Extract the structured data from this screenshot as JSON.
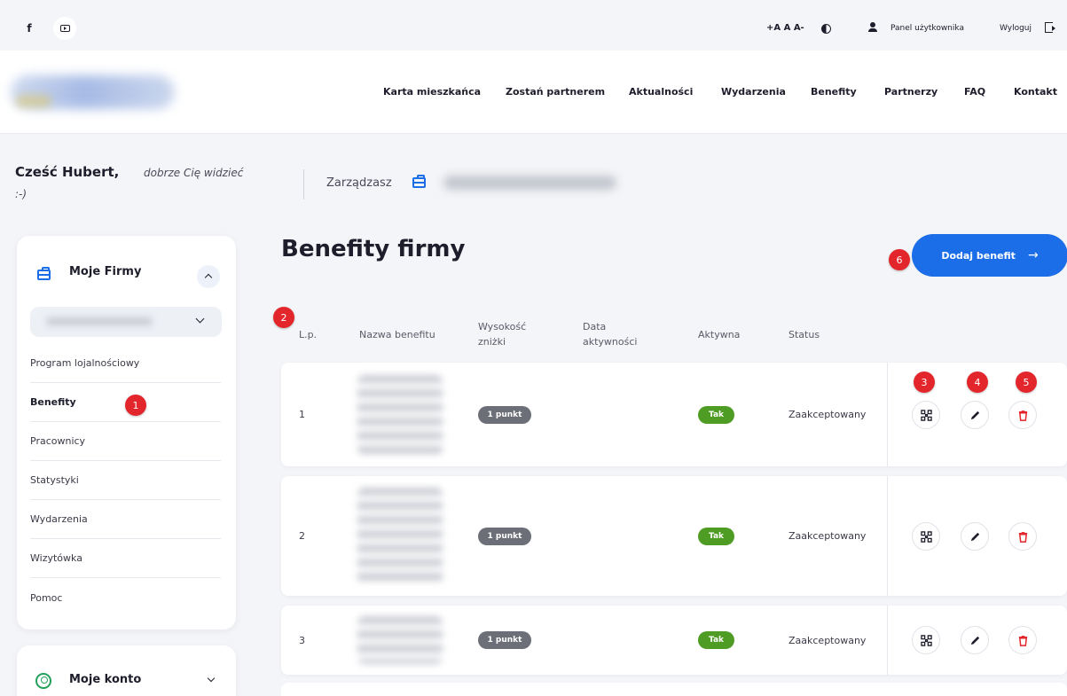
{
  "topbar": {
    "social": [
      {
        "icon": "facebook-icon",
        "label": "f"
      },
      {
        "icon": "youtube-icon"
      }
    ],
    "font_size_controls": "+A A A-",
    "contrast_icon": "contrast-icon",
    "user_panel_label": "Panel użytkownika",
    "logout_label": "Wyloguj"
  },
  "nav": {
    "items": [
      "Karta mieszkańca",
      "Zostań partnerem",
      "Aktualności",
      "Wydarzenia",
      "Benefity",
      "Partnerzy",
      "FAQ",
      "Kontakt"
    ]
  },
  "greeting": {
    "name": "Cześć Hubert,",
    "sub_line1": "dobrze Cię widzieć",
    "sub_line2": ":-)",
    "manage_label": "Zarządzasz"
  },
  "sidebar": {
    "firms_title": "Moje Firmy",
    "items": [
      {
        "label": "Program lojalnościowy",
        "active": false
      },
      {
        "label": "Benefity",
        "active": true
      },
      {
        "label": "Pracownicy",
        "active": false
      },
      {
        "label": "Statystyki",
        "active": false
      },
      {
        "label": "Wydarzenia",
        "active": false
      },
      {
        "label": "Wizytówka",
        "active": false
      },
      {
        "label": "Pomoc",
        "active": false
      }
    ],
    "account_title": "Moje konto"
  },
  "main": {
    "title": "Benefity firmy",
    "add_button_label": "Dodaj benefit",
    "add_button_arrow": "→",
    "columns": {
      "lp": "L.p.",
      "name": "Nazwa benefitu",
      "discount_l1": "Wysokość",
      "discount_l2": "zniżki",
      "date_l1": "Data",
      "date_l2": "aktywności",
      "active": "Aktywna",
      "status": "Status"
    },
    "rows": [
      {
        "lp": "1",
        "discount": "1 punkt",
        "active": "Tak",
        "status": "Zaakceptowany"
      },
      {
        "lp": "2",
        "discount": "1 punkt",
        "active": "Tak",
        "status": "Zaakceptowany"
      },
      {
        "lp": "3",
        "discount": "1 punkt",
        "active": "Tak",
        "status": "Zaakceptowany"
      }
    ]
  },
  "markers": [
    "1",
    "2",
    "3",
    "4",
    "5",
    "6"
  ],
  "colors": {
    "accent": "#1b6ee8",
    "marker": "#e3262b",
    "active_pill": "#4e9c24",
    "discount_pill": "#6d6f78",
    "account_icon": "#23a15a"
  }
}
